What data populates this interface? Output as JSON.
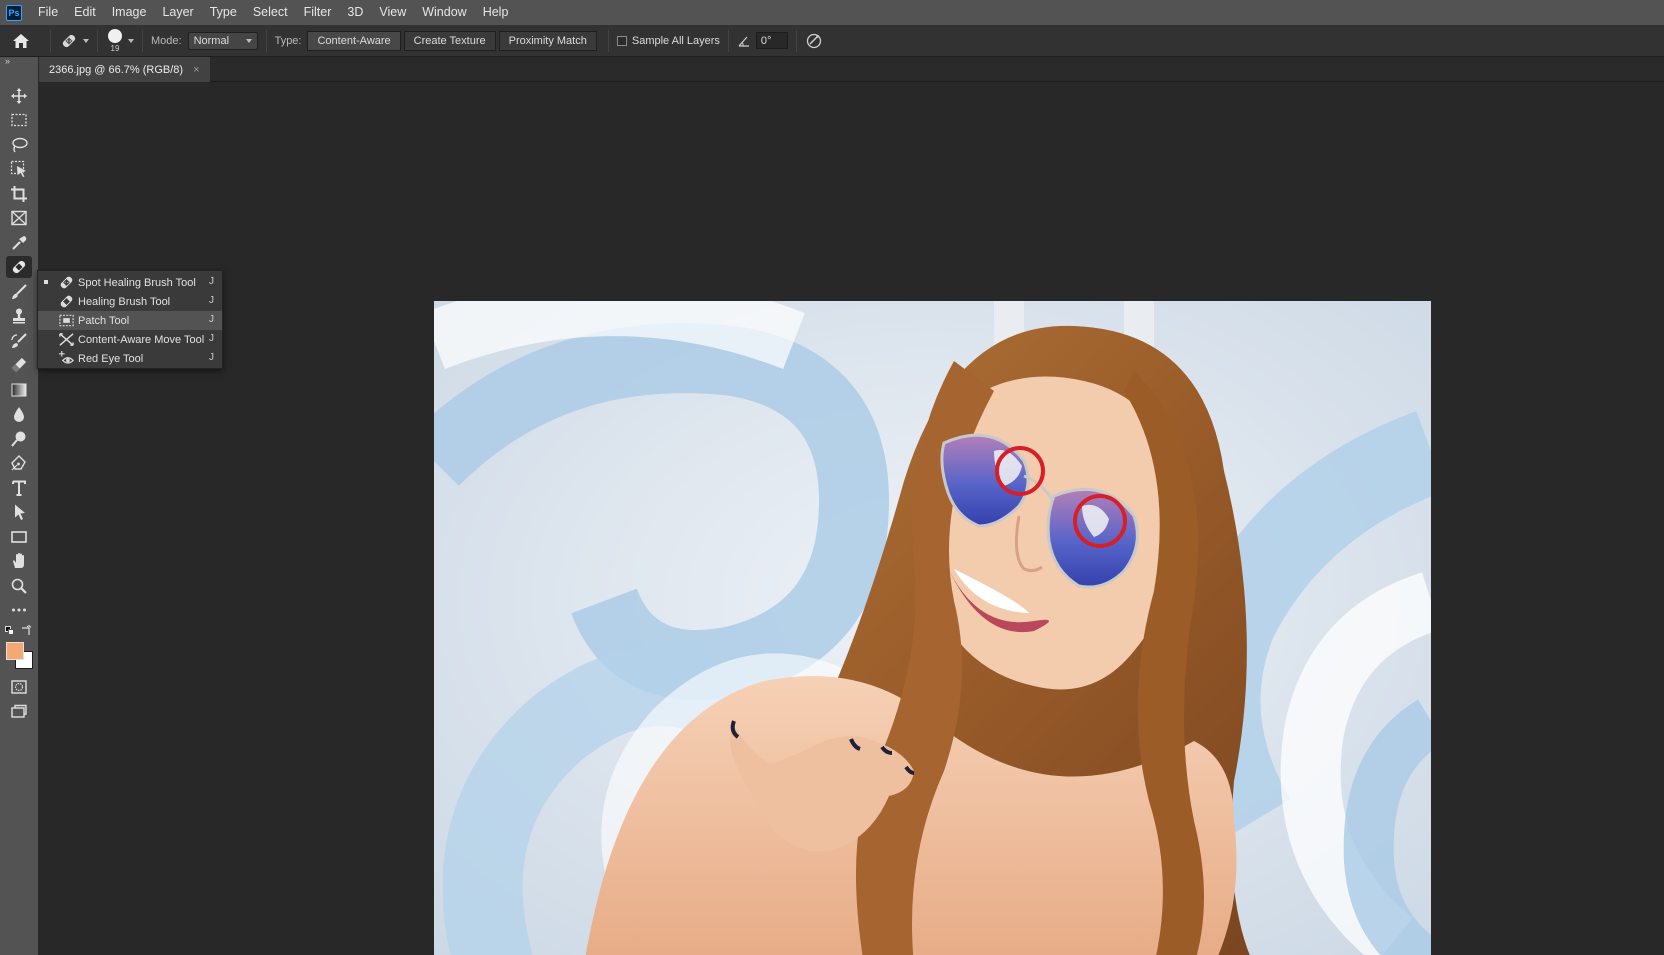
{
  "app": {
    "logo_text": "Ps",
    "menu": [
      "File",
      "Edit",
      "Image",
      "Layer",
      "Type",
      "Select",
      "Filter",
      "3D",
      "View",
      "Window",
      "Help"
    ]
  },
  "options": {
    "brush_size": "19",
    "mode_label": "Mode:",
    "mode_value": "Normal",
    "type_label": "Type:",
    "type_buttons": [
      "Content-Aware",
      "Create Texture",
      "Proximity Match"
    ],
    "active_type": "Content-Aware",
    "sample_all_layers_label": "Sample All Layers",
    "sample_all_layers_checked": false,
    "angle_value": "0°"
  },
  "document": {
    "tab_title": "2366.jpg @ 66.7% (RGB/8)",
    "close_glyph": "×"
  },
  "toolbar": {
    "collapse_glyph": "»",
    "active_tool": "healing-brush-group",
    "foreground_color": "#f4a973",
    "background_color": "#ffffff"
  },
  "flyout": {
    "items": [
      {
        "label": "Spot Healing Brush Tool",
        "shortcut": "J",
        "selected": true,
        "icon": "spot-healing-icon"
      },
      {
        "label": "Healing Brush Tool",
        "shortcut": "J",
        "selected": false,
        "icon": "healing-brush-icon"
      },
      {
        "label": "Patch Tool",
        "shortcut": "J",
        "selected": false,
        "icon": "patch-icon"
      },
      {
        "label": "Content-Aware Move Tool",
        "shortcut": "J",
        "selected": false,
        "icon": "content-aware-move-icon"
      },
      {
        "label": "Red Eye Tool",
        "shortcut": "J",
        "selected": false,
        "icon": "red-eye-icon"
      }
    ]
  },
  "colors": {
    "annotation_circle": "#d61f26"
  }
}
